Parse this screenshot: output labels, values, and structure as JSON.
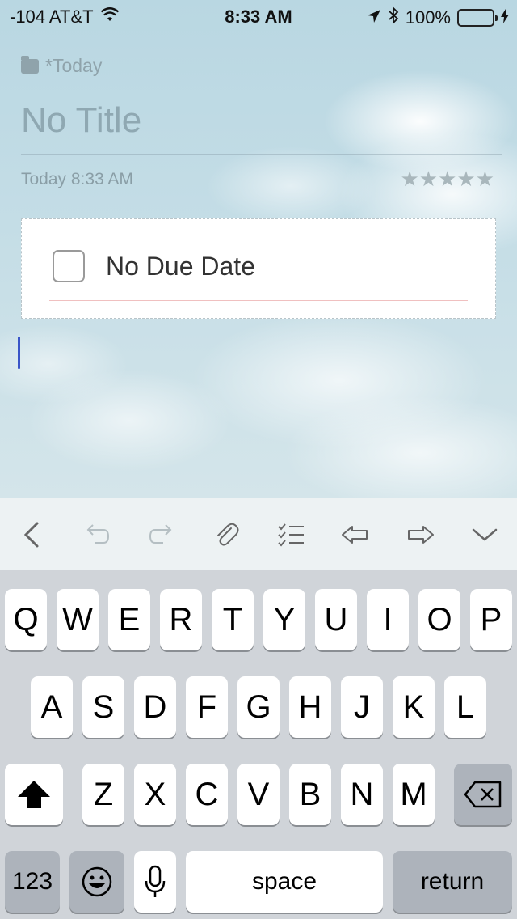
{
  "status_bar": {
    "carrier": "-104 AT&T",
    "time": "8:33 AM",
    "battery": "100%"
  },
  "note": {
    "folder": "*Today",
    "title": "No Title",
    "date": "Today 8:33 AM",
    "rating_stars": "★★★★★"
  },
  "task": {
    "label": "No Due Date",
    "checked": false
  },
  "toolbar": {
    "icons": [
      "back-icon",
      "undo-icon",
      "redo-icon",
      "attachment-icon",
      "checklist-icon",
      "outdent-icon",
      "indent-icon",
      "dismiss-keyboard-icon"
    ]
  },
  "keyboard": {
    "row1": [
      "Q",
      "W",
      "E",
      "R",
      "T",
      "Y",
      "U",
      "I",
      "O",
      "P"
    ],
    "row2": [
      "A",
      "S",
      "D",
      "F",
      "G",
      "H",
      "J",
      "K",
      "L"
    ],
    "row3": [
      "Z",
      "X",
      "C",
      "V",
      "B",
      "N",
      "M"
    ],
    "numbers_label": "123",
    "space_label": "space",
    "return_label": "return"
  }
}
